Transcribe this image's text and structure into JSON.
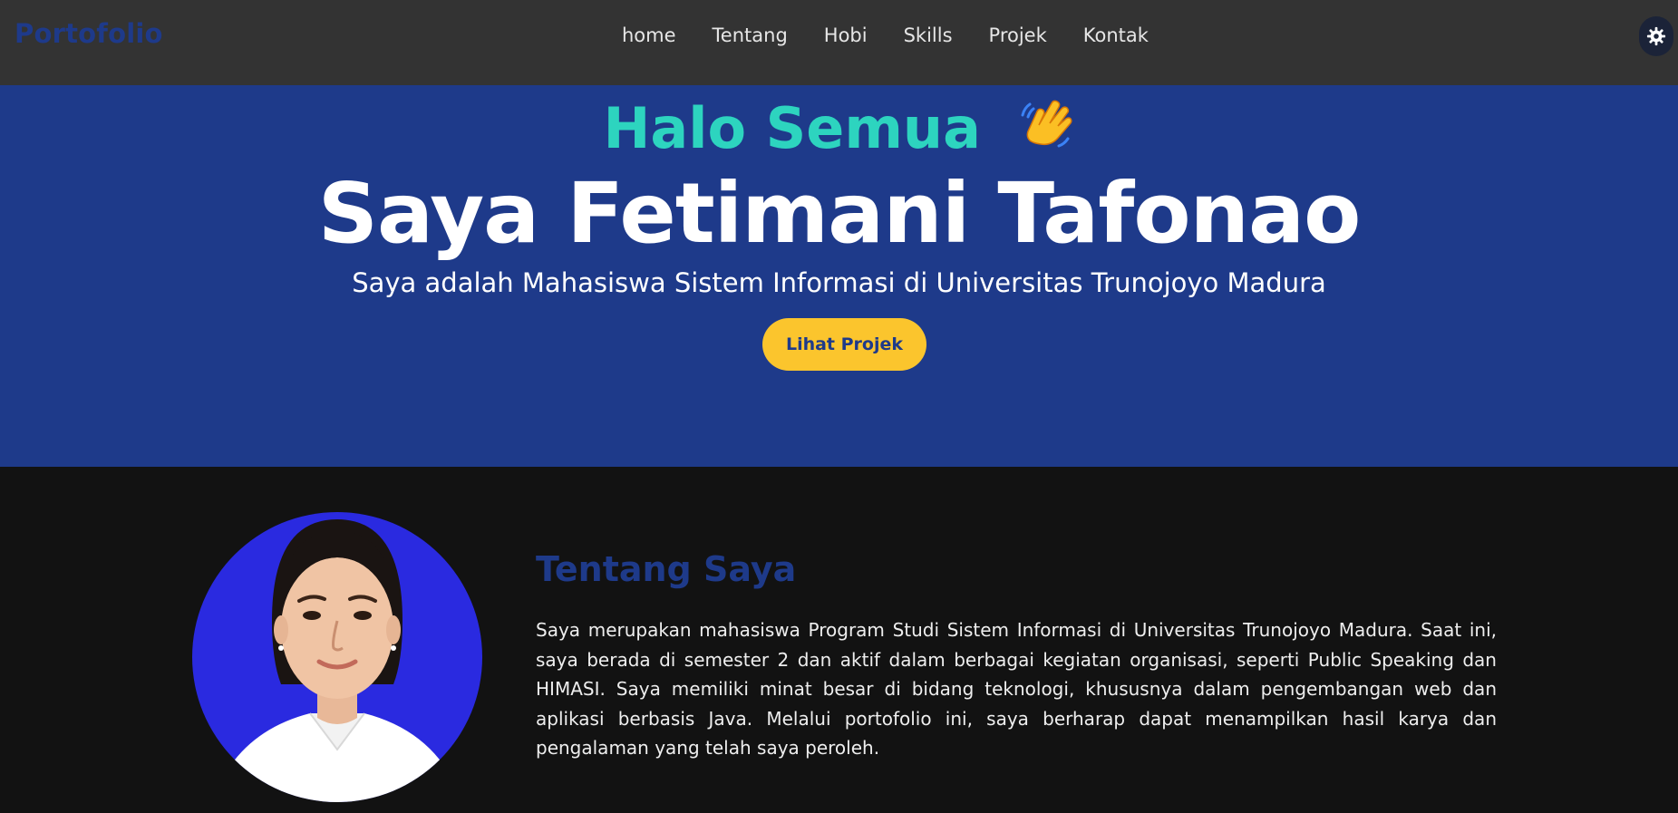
{
  "navbar": {
    "brand": "Portofolio",
    "links": [
      "home",
      "Tentang",
      "Hobi",
      "Skills",
      "Projek",
      "Kontak"
    ],
    "theme_toggle_icon": "gear-icon"
  },
  "hero": {
    "greeting": "Halo Semua",
    "greeting_icon": "waving-hand-icon",
    "name": "Saya Fetimani Tafonao",
    "subtitle": "Saya adalah Mahasiswa Sistem Informasi di Universitas Trunojoyo Madura",
    "cta_label": "Lihat Projek"
  },
  "about": {
    "title": "Tentang Saya",
    "text": "Saya merupakan mahasiswa Program Studi Sistem Informasi di Universitas Trunojoyo Madura. Saat ini, saya berada di semester 2 dan aktif dalam berbagai kegiatan organisasi, seperti Public Speaking dan HIMASI. Saya memiliki minat besar di bidang teknologi, khususnya dalam pengembangan web dan aplikasi berbasis Java. Melalui portofolio ini, saya berharap dapat menampilkan hasil karya dan pengalaman yang telah saya peroleh.",
    "photo": "profile-photo"
  },
  "colors": {
    "nav_bg": "#333333",
    "hero_bg": "#1e3a8a",
    "accent_teal": "#2dd4bf",
    "button_yellow": "#fbc52d",
    "page_bg": "#121212"
  }
}
